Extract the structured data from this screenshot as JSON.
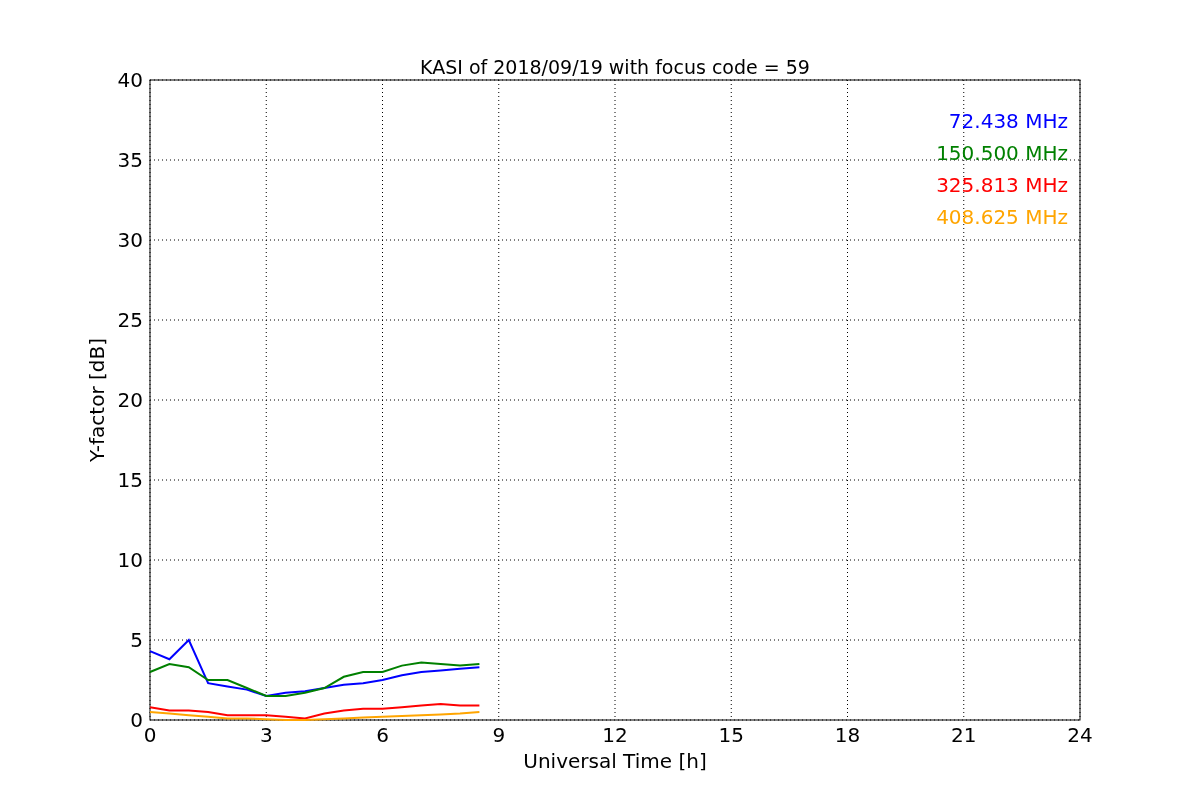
{
  "chart_data": {
    "type": "line",
    "title": "KASI of 2018/09/19 with focus code = 59",
    "xlabel": "Universal Time [h]",
    "ylabel": "Y-factor [dB]",
    "x": [
      0,
      0.5,
      1,
      1.5,
      2,
      2.5,
      3,
      3.5,
      4,
      4.5,
      5,
      5.5,
      6,
      6.5,
      7,
      7.5,
      8,
      8.5
    ],
    "series": [
      {
        "name": "72.438 MHz",
        "color": "#0000ff",
        "values": [
          4.3,
          3.8,
          5,
          2.3,
          2.1,
          1.9,
          1.5,
          1.7,
          1.8,
          2.0,
          2.2,
          2.3,
          2.5,
          2.8,
          3.0,
          3.1,
          3.2,
          3.3
        ]
      },
      {
        "name": "150.500 MHz",
        "color": "#008000",
        "values": [
          3.0,
          3.5,
          3.3,
          2.5,
          2.5,
          2.0,
          1.5,
          1.5,
          1.7,
          2.0,
          2.7,
          3.0,
          3.0,
          3.4,
          3.6,
          3.5,
          3.4,
          3.5
        ]
      },
      {
        "name": "325.813 MHz",
        "color": "#ff0000",
        "values": [
          0.8,
          0.6,
          0.6,
          0.5,
          0.3,
          0.3,
          0.3,
          0.2,
          0.1,
          0.4,
          0.6,
          0.7,
          0.7,
          0.8,
          0.9,
          1.0,
          0.9,
          0.9
        ]
      },
      {
        "name": "408.625 MHz",
        "color": "#ffa500",
        "values": [
          0.5,
          0.4,
          0.3,
          0.2,
          0.1,
          0.1,
          0.05,
          0,
          0,
          0.05,
          0.1,
          0.15,
          0.2,
          0.25,
          0.3,
          0.35,
          0.4,
          0.5
        ]
      }
    ],
    "xlim": [
      0,
      24
    ],
    "ylim": [
      0,
      40
    ],
    "xticks": [
      0,
      3,
      6,
      9,
      12,
      15,
      18,
      21,
      24
    ],
    "yticks": [
      0,
      5,
      10,
      15,
      20,
      25,
      30,
      35,
      40
    ],
    "grid": true
  }
}
